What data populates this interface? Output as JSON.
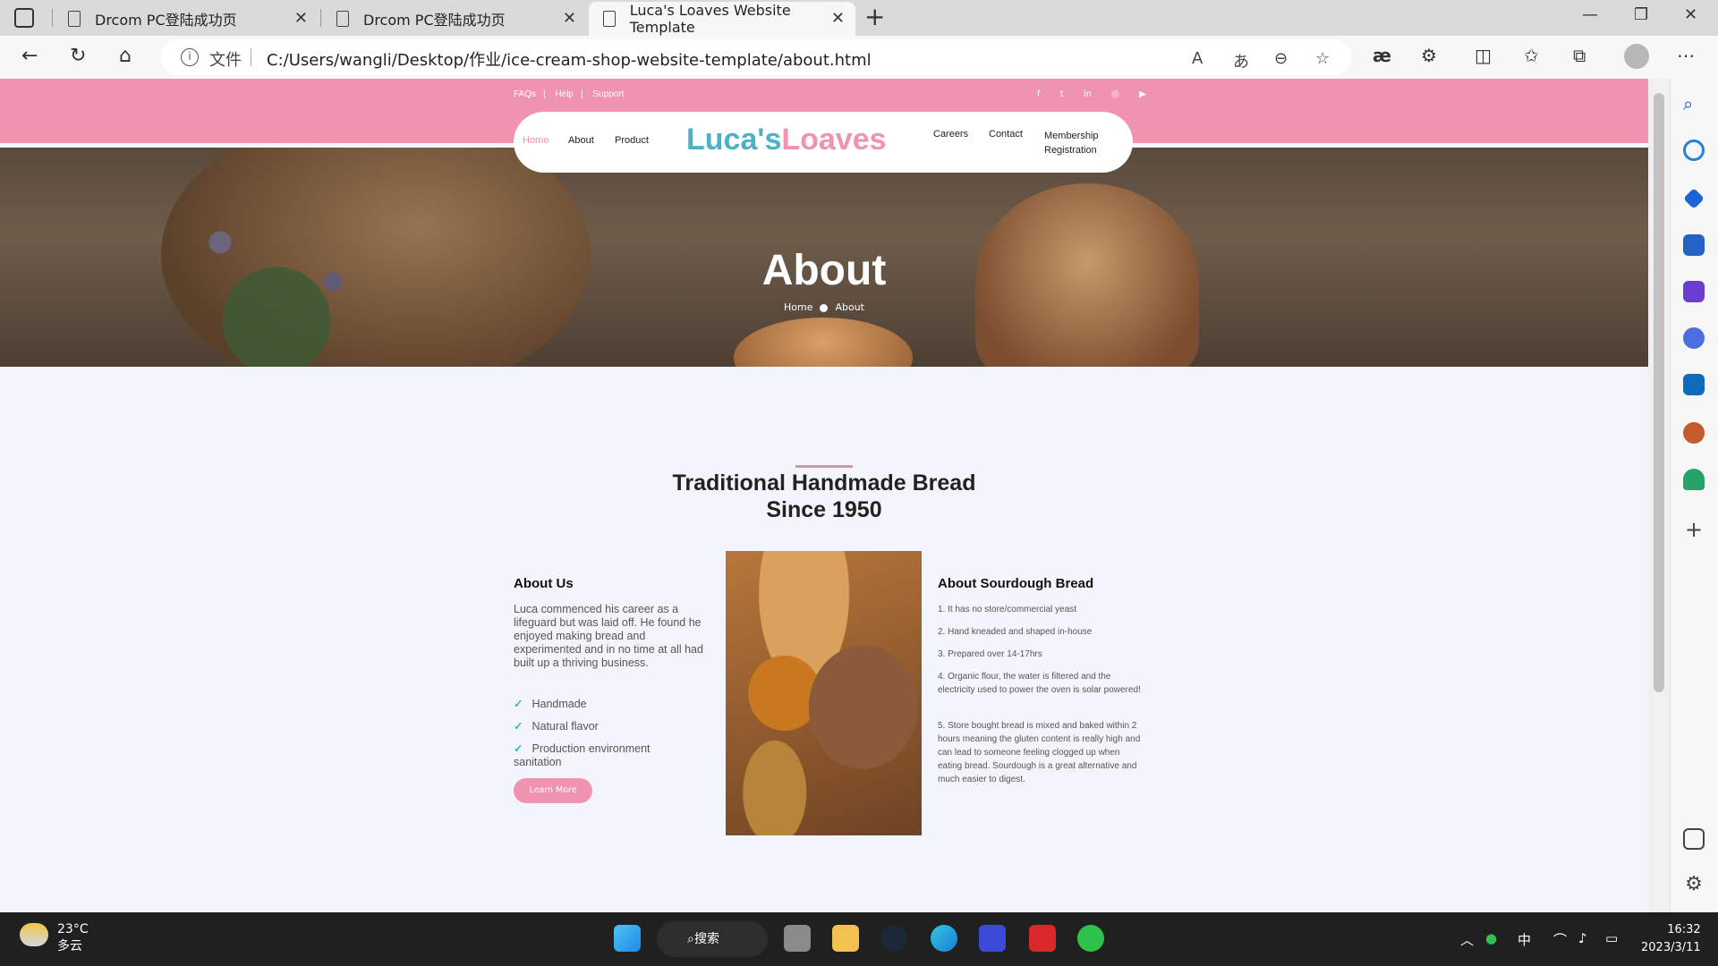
{
  "browser": {
    "tabs": [
      {
        "title": "Drcom PC登陆成功页"
      },
      {
        "title": "Drcom PC登陆成功页"
      },
      {
        "title": "Luca's Loaves Website Template"
      }
    ],
    "address": {
      "file_label": "文件",
      "url": "C:/Users/wangli/Desktop/作业/ice-cream-shop-website-template/about.html"
    }
  },
  "site": {
    "toplinks": [
      "FAQs",
      "Help",
      "Support"
    ],
    "toplink_sep": "|",
    "social": [
      "f",
      "t",
      "in",
      "◎",
      "▶"
    ],
    "nav_left": [
      "Home",
      "About",
      "Product"
    ],
    "nav_right": [
      "Careers",
      "Contact",
      "Membership Registration"
    ],
    "logo": {
      "part1": "Luca's",
      "part2": "Loaves"
    },
    "hero": {
      "title": "About",
      "crumb_home": "Home",
      "crumb_current": "About"
    },
    "section": {
      "title_line1": "Traditional Handmade Bread",
      "title_line2": "Since 1950"
    },
    "about": {
      "heading": "About Us",
      "text": "Luca commenced his career as a lifeguard but was laid off. He found he enjoyed making bread and experimented and in no time at all had built up a thriving business.",
      "features": [
        "Handmade",
        "Natural flavor",
        "Production environment sanitation"
      ],
      "button": "Learn More"
    },
    "sourdough": {
      "heading": "About Sourdough Bread",
      "items": [
        "1. It has no store/commercial yeast",
        "2. Hand kneaded and shaped in-house",
        "3. Prepared over 14-17hrs",
        "4. Organic flour, the water is filtered and the electricity used to power the oven is solar powered!",
        "5. Store bought bread is mixed and baked within 2 hours meaning the gluten content is really high and can lead to someone feeling clogged up when eating bread. Sourdough is a great alternative and much easier to digest."
      ]
    }
  },
  "taskbar": {
    "temperature": "23°C",
    "weather": "多云",
    "search": "搜索",
    "ime": "中",
    "time": "16:32",
    "date": "2023/3/11"
  },
  "colors": {
    "pink": "#f093b0",
    "teal_logo": "#4ab3c6",
    "pink_logo": "#f093b0"
  }
}
